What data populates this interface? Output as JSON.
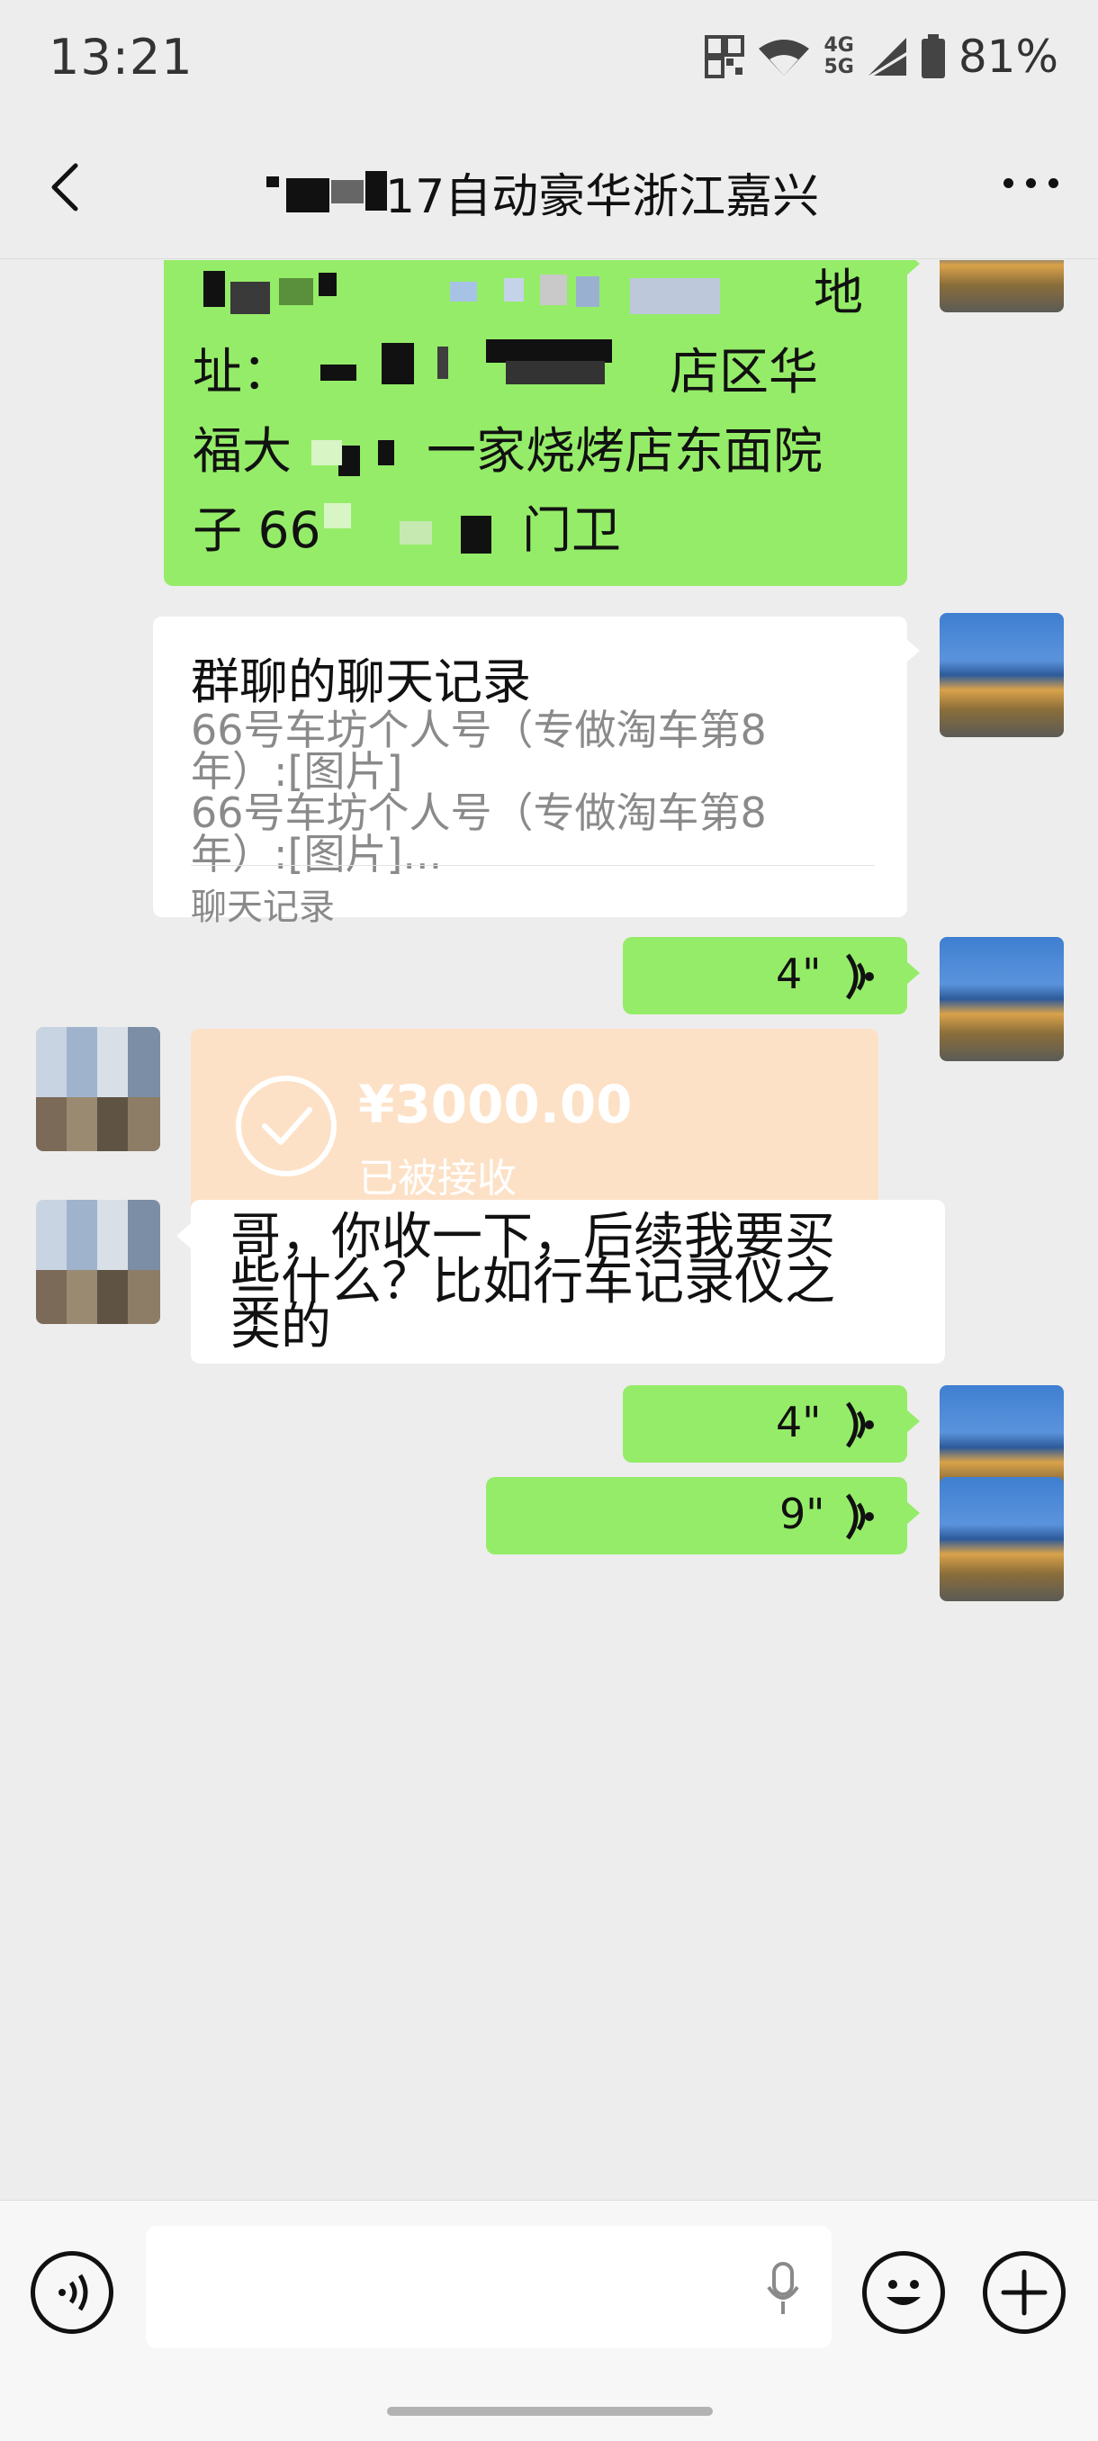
{
  "status_bar": {
    "time": "13:21",
    "network_top": "4G",
    "network_bottom": "5G",
    "battery": "81%"
  },
  "header": {
    "title": "17自动豪华浙江嘉兴",
    "more_icon": "more-horizontal-icon",
    "back_icon": "chevron-left-icon"
  },
  "messages": {
    "address": {
      "line1_end": "地",
      "line2_start": "址：",
      "line2_end": "店区华",
      "line3_start": "福大",
      "line3_end": "一家烧烤店东面院",
      "line4_start": "子 66",
      "line4_end": "门卫"
    },
    "chat_record_card": {
      "title": "群聊的聊天记录",
      "line1": "66号车坊个人号（专做淘车第8",
      "line2": "年）:[图片]",
      "line3": "66号车坊个人号（专做淘车第8",
      "line4": "年）:[图片]...",
      "footer": "聊天记录"
    },
    "voice1": {
      "duration": "4\""
    },
    "transfer": {
      "amount": "¥3000.00",
      "status": "已被接收"
    },
    "text_message": {
      "line1": "哥，你收一下，后续我要买",
      "line2": "些什么？比如行车记录仪之",
      "line3": "类的"
    },
    "voice2": {
      "duration": "4\""
    },
    "voice3": {
      "duration": "9\""
    }
  },
  "input_bar": {
    "voice_toggle_icon": "voice-mode-icon",
    "mic_icon": "microphone-icon",
    "emoji_icon": "emoji-icon",
    "plus_icon": "plus-icon"
  },
  "colors": {
    "chat_background": "#ededed",
    "sent_bubble": "#95ec69",
    "received_bubble": "#ffffff",
    "transfer_accepted": "#fde1c6"
  }
}
